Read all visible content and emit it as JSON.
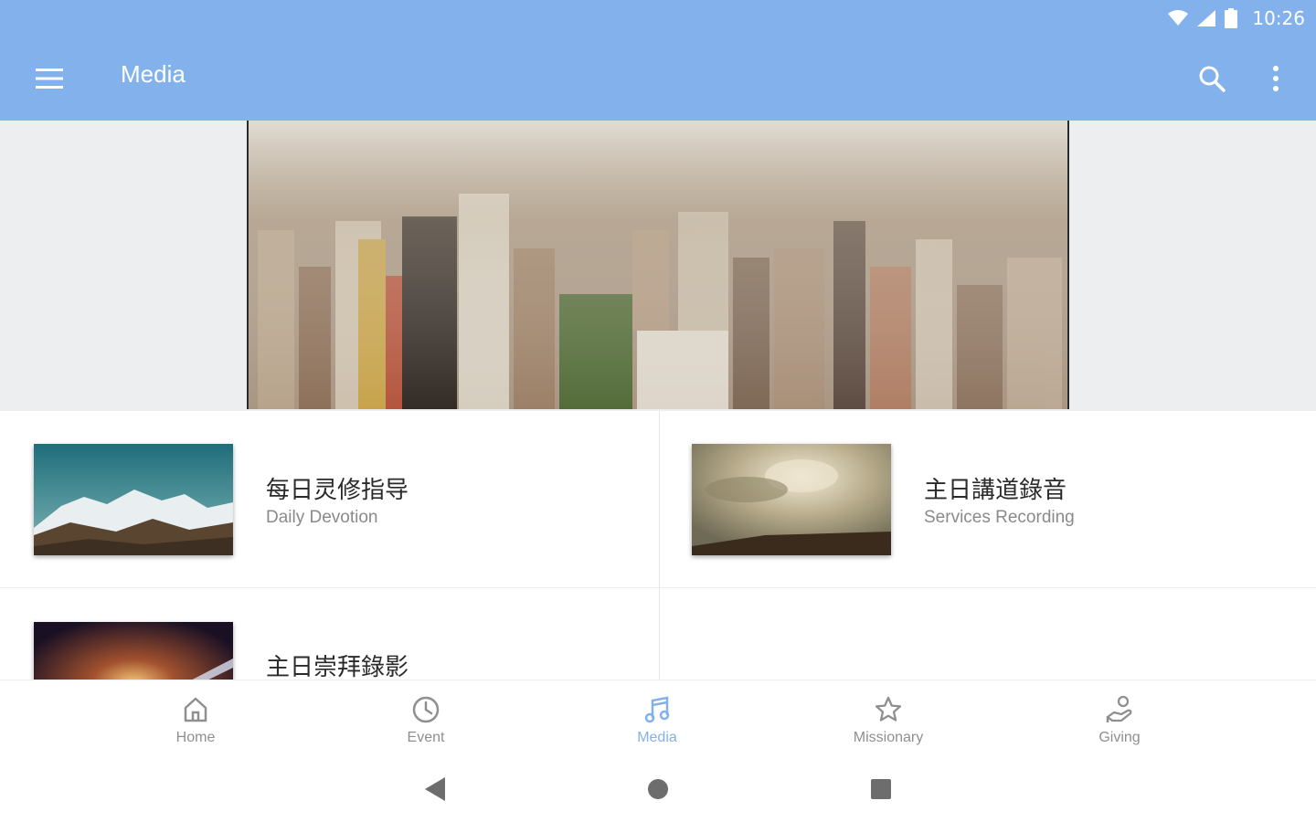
{
  "status_bar": {
    "time": "10:26",
    "icons": [
      "wifi-icon",
      "signal-icon",
      "battery-icon"
    ]
  },
  "app_bar": {
    "title": "Media",
    "icons": [
      "menu-icon",
      "search-icon",
      "more-vert-icon"
    ]
  },
  "cards": [
    {
      "title": "每日灵修指导",
      "subtitle": "Daily Devotion",
      "thumb": "mountain-landscape"
    },
    {
      "title": "主日講道錄音",
      "subtitle": "Services Recording",
      "thumb": "cloudy-sky"
    },
    {
      "title": "主日崇拜錄影",
      "subtitle": "",
      "thumb": "stage-lights"
    }
  ],
  "bottom_nav": {
    "items": [
      {
        "label": "Home",
        "icon": "home-icon",
        "active": false
      },
      {
        "label": "Event",
        "icon": "clock-icon",
        "active": false
      },
      {
        "label": "Media",
        "icon": "music-note-icon",
        "active": true
      },
      {
        "label": "Missionary",
        "icon": "star-icon",
        "active": false
      },
      {
        "label": "Giving",
        "icon": "giving-hand-icon",
        "active": false
      }
    ]
  },
  "colors": {
    "primary": "#83b1ec",
    "inactive": "#8f8f8f",
    "hero_bg": "#eceef0"
  }
}
